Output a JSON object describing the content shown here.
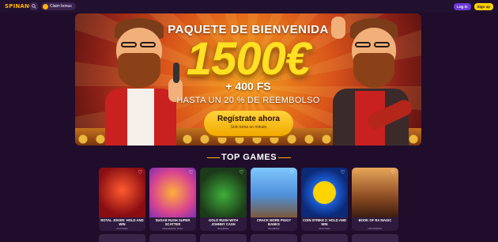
{
  "header": {
    "logo": "SPINANGA",
    "claim_bonus": "Claim bonus",
    "login": "Log in",
    "signup": "Sign up"
  },
  "banner": {
    "title": "PAQUETE DE BIENVENIDA",
    "amount": "1500€",
    "free_spins": "+ 400 FS",
    "cashback": "HASTA UN 20 % DE REEMBOLSO",
    "cta": "Regístrate ahora",
    "cta_sub": "Solo toma un minuto"
  },
  "top_games": {
    "title": "TOP GAMES",
    "games": [
      {
        "name": "ROYAL JOKER: HOLD AND WIN",
        "provider": "PLAYSON"
      },
      {
        "name": "SUGAR RUSH SUPER SCATTER",
        "provider": "PRAGMATIC PLAY"
      },
      {
        "name": "GOLD RUSH WITH JOHNNY CASH",
        "provider": "BGAMING"
      },
      {
        "name": "CRACK MORE PIGGY BANKS",
        "provider": "BGAMING"
      },
      {
        "name": "COIN STRIKE 2: HOLD AND WIN",
        "provider": "PLAYSON"
      },
      {
        "name": "BOOK OF RA MAGIC",
        "provider": "NOVOMATIC"
      }
    ]
  },
  "colors": {
    "background": "#1f0d2b",
    "accent_yellow": "#ffd400",
    "login_purple": "#6a3bd8"
  }
}
